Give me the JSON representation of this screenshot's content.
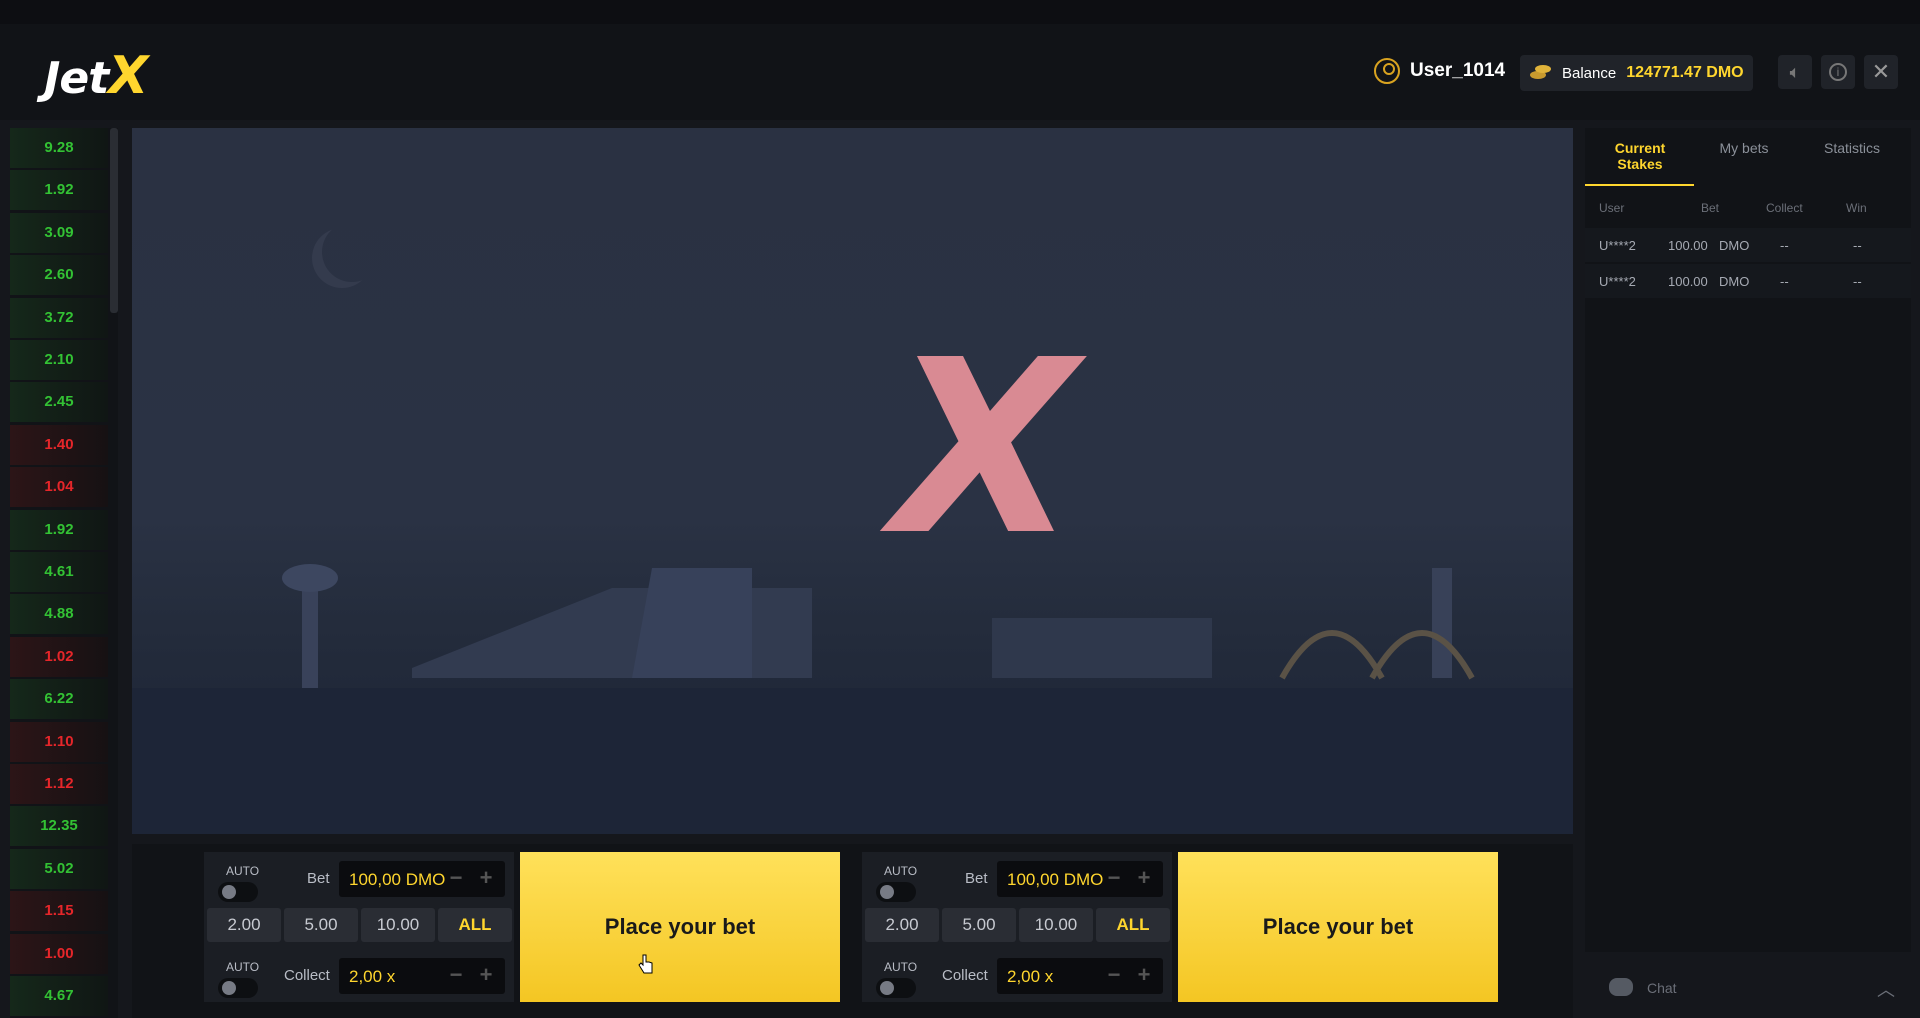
{
  "header": {
    "logo_main": "Jet",
    "logo_x": "X",
    "username": "User_1014",
    "balance_label": "Balance",
    "balance_value": "124771.47 DMO",
    "sound_icon": "speaker-icon",
    "info_icon": "info-icon",
    "close_icon": "close-icon"
  },
  "history": [
    {
      "value": "9.28",
      "color": "green"
    },
    {
      "value": "1.92",
      "color": "green"
    },
    {
      "value": "3.09",
      "color": "green"
    },
    {
      "value": "2.60",
      "color": "green"
    },
    {
      "value": "3.72",
      "color": "green"
    },
    {
      "value": "2.10",
      "color": "green"
    },
    {
      "value": "2.45",
      "color": "green"
    },
    {
      "value": "1.40",
      "color": "red"
    },
    {
      "value": "1.04",
      "color": "red"
    },
    {
      "value": "1.92",
      "color": "green"
    },
    {
      "value": "4.61",
      "color": "green"
    },
    {
      "value": "4.88",
      "color": "green"
    },
    {
      "value": "1.02",
      "color": "red"
    },
    {
      "value": "6.22",
      "color": "green"
    },
    {
      "value": "1.10",
      "color": "red"
    },
    {
      "value": "1.12",
      "color": "red"
    },
    {
      "value": "12.35",
      "color": "green"
    },
    {
      "value": "5.02",
      "color": "green"
    },
    {
      "value": "1.15",
      "color": "red"
    },
    {
      "value": "1.00",
      "color": "red"
    },
    {
      "value": "4.67",
      "color": "green"
    }
  ],
  "game": {
    "mark": "X"
  },
  "bet_panels": [
    {
      "auto_label": "AUTO",
      "bet_label": "Bet",
      "bet_value": "100,00 DMO",
      "quick": [
        "2.00",
        "5.00",
        "10.00",
        "ALL"
      ],
      "auto_label2": "AUTO",
      "collect_label": "Collect",
      "collect_value": "2,00 x",
      "button": "Place your bet"
    },
    {
      "auto_label": "AUTO",
      "bet_label": "Bet",
      "bet_value": "100,00 DMO",
      "quick": [
        "2.00",
        "5.00",
        "10.00",
        "ALL"
      ],
      "auto_label2": "AUTO",
      "collect_label": "Collect",
      "collect_value": "2,00 x",
      "button": "Place your bet"
    }
  ],
  "side": {
    "tabs": [
      "Current Stakes",
      "My bets",
      "Statistics"
    ],
    "columns": [
      "User",
      "Bet",
      "Collect",
      "Win"
    ],
    "rows": [
      {
        "user": "U****2",
        "bet": "100.00",
        "currency": "DMO",
        "collect": "--",
        "win": "--"
      },
      {
        "user": "U****2",
        "bet": "100.00",
        "currency": "DMO",
        "collect": "--",
        "win": "--"
      }
    ],
    "chat_label": "Chat"
  },
  "colors": {
    "accent": "#ffd62e",
    "win_green": "#33c234",
    "loss_red": "#e6262a"
  }
}
